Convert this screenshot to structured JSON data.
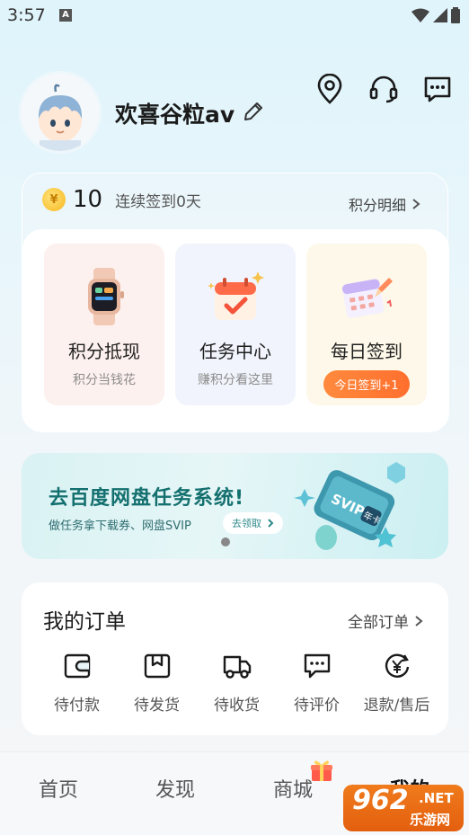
{
  "status_bar": {
    "time": "3:57",
    "notice_badge": "A"
  },
  "profile": {
    "username": "欢喜谷粒av"
  },
  "points": {
    "coin_symbol": "¥",
    "value": "10",
    "streak": "连续签到0天",
    "detail_link": "积分明细",
    "tiles": [
      {
        "title": "积分抵现",
        "subtitle": "积分当钱花",
        "icon": "smartwatch-icon"
      },
      {
        "title": "任务中心",
        "subtitle": "赚积分看这里",
        "icon": "calendar-check-icon"
      },
      {
        "title": "每日签到",
        "button": "今日签到+1",
        "icon": "calendar-pen-icon"
      }
    ]
  },
  "banner": {
    "title": "去百度网盘任务系统!",
    "subtitle": "做任务拿下载券、网盘SVIP",
    "button": "去领取",
    "ticket_text": "SVIP",
    "ticket_sub": "年卡"
  },
  "orders": {
    "title": "我的订单",
    "all_link": "全部订单",
    "items": [
      {
        "label": "待付款",
        "icon": "wallet-icon"
      },
      {
        "label": "待发货",
        "icon": "package-icon"
      },
      {
        "label": "待收货",
        "icon": "truck-icon"
      },
      {
        "label": "待评价",
        "icon": "comment-icon"
      },
      {
        "label": "退款/售后",
        "icon": "refund-icon"
      }
    ]
  },
  "bottom_nav": [
    "首页",
    "发现",
    "商城",
    "我的"
  ],
  "watermark": {
    "number": "962",
    "net": ".NET",
    "cn": "乐游网"
  },
  "colors": {
    "accent": "#ff7a33",
    "banner_text": "#14706f"
  }
}
